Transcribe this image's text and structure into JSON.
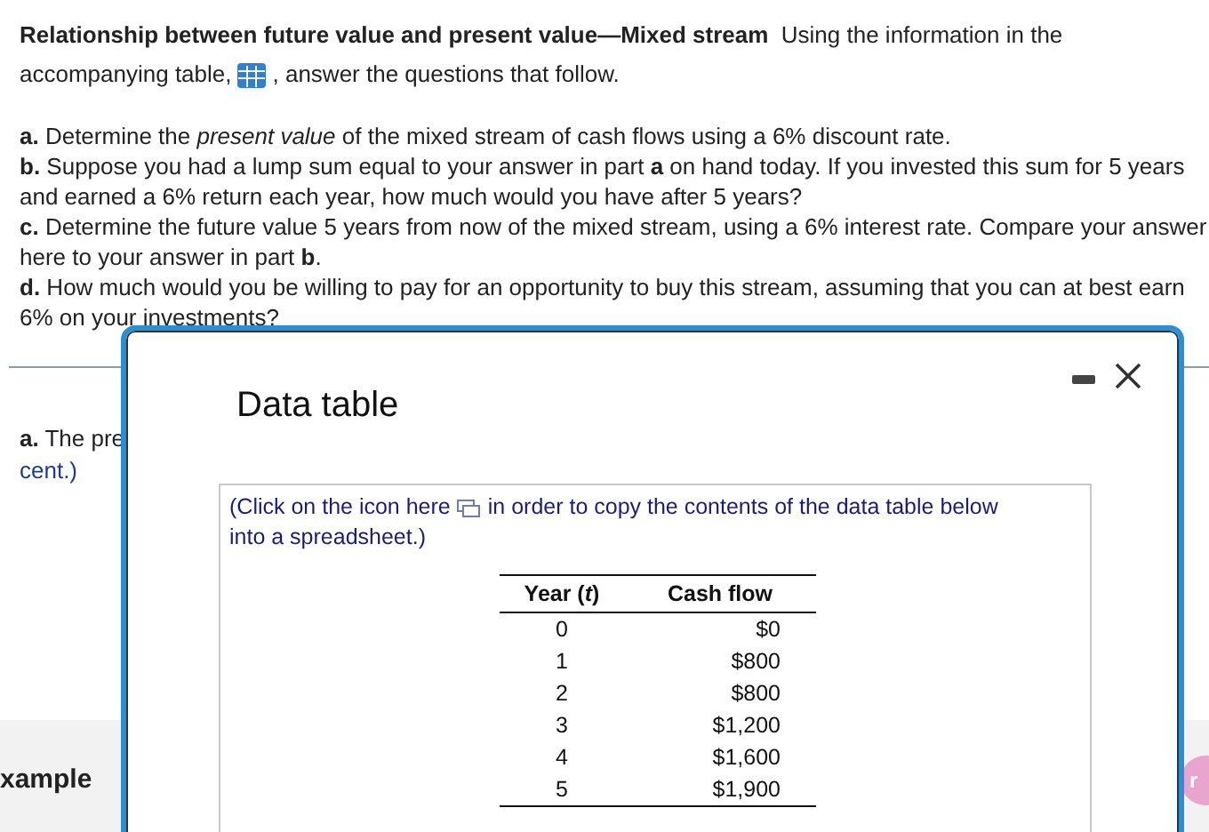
{
  "problem": {
    "intro_line": "**Relationship between future value and present value—Mixed stream**  Using the information in the",
    "intro_before": "accompanying table,",
    "intro_after": ", answer the questions that follow.",
    "questions": [
      "**a.**  Determine the *present value* of the mixed stream of cash flows using a 6% discount rate.",
      "**b.** Suppose you had a lump sum equal to your answer in part **a** on hand today. If you invested this sum for 5 years and earned a 6% return each year, how much would you have after 5 years?",
      "**c.** Determine the future value 5 years from now of the mixed stream, using a 6% interest rate. Compare your answer here to your answer in part **b**.",
      "**d.**  How much would you be willing to pay for an opportunity to buy this stream, assuming that you can at best earn 6% on your investments?"
    ]
  },
  "answer_area": {
    "prompt": "**a.** The pre",
    "prompt_end": "cent.)",
    "example_label": "xample",
    "badge": "r"
  },
  "dialog": {
    "title": "Data table",
    "note_before": "(Click on the icon here",
    "note_after": "in order to copy the contents of the data table below",
    "note_end": "into a spreadsheet.)",
    "table": {
      "columns": [
        "Year (*t*)",
        "Cash flow"
      ],
      "rows": [
        [
          "0",
          "$0"
        ],
        [
          "1",
          "$800"
        ],
        [
          "2",
          "$800"
        ],
        [
          "3",
          "$1,200"
        ],
        [
          "4",
          "$1,600"
        ],
        [
          "5",
          "$1,900"
        ]
      ]
    }
  }
}
